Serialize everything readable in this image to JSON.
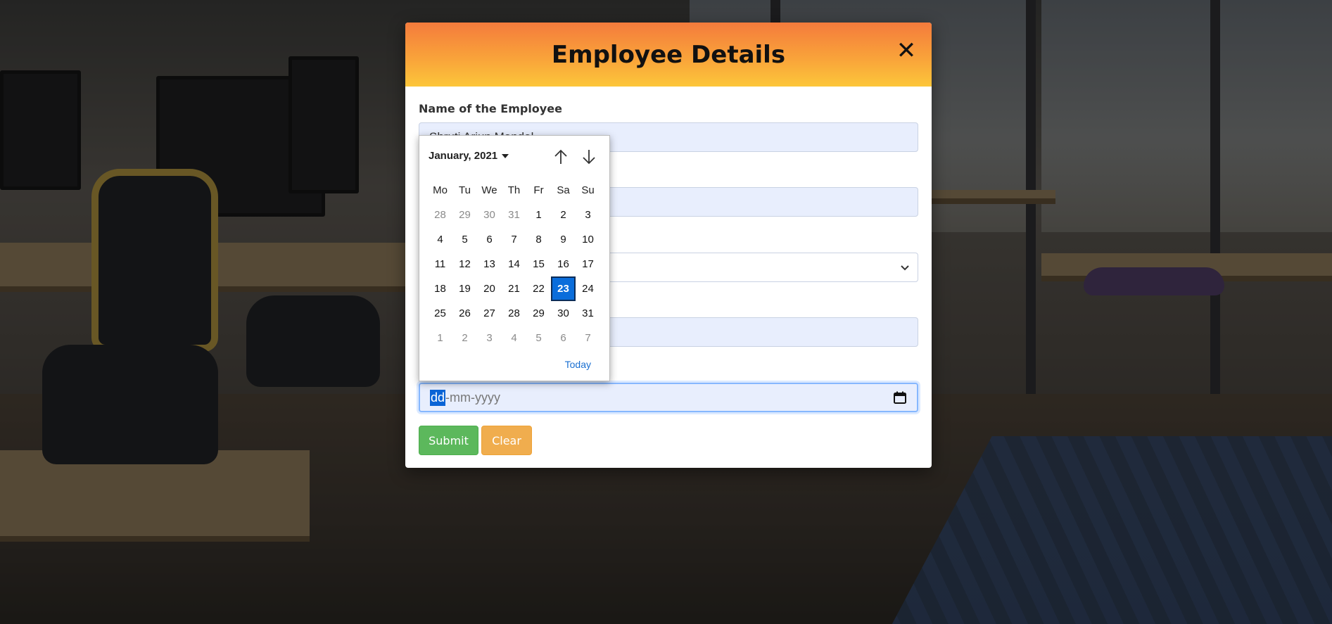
{
  "modal": {
    "title": "Employee Details",
    "close_label": "✕"
  },
  "form": {
    "name_label": "Name of the Employee",
    "name_value": "Shruti Arjun Mandal",
    "date_placeholder_day": "dd",
    "date_placeholder_rest": "-mm-yyyy",
    "submit_label": "Submit",
    "clear_label": "Clear"
  },
  "datepicker": {
    "month_year": "January, 2021",
    "weekdays": [
      "Mo",
      "Tu",
      "We",
      "Th",
      "Fr",
      "Sa",
      "Su"
    ],
    "weeks": [
      [
        "28",
        "29",
        "30",
        "31",
        "1",
        "2",
        "3"
      ],
      [
        "4",
        "5",
        "6",
        "7",
        "8",
        "9",
        "10"
      ],
      [
        "11",
        "12",
        "13",
        "14",
        "15",
        "16",
        "17"
      ],
      [
        "18",
        "19",
        "20",
        "21",
        "22",
        "23",
        "24"
      ],
      [
        "25",
        "26",
        "27",
        "28",
        "29",
        "30",
        "31"
      ],
      [
        "1",
        "2",
        "3",
        "4",
        "5",
        "6",
        "7"
      ]
    ],
    "selected_day": "23",
    "today_label": "Today"
  },
  "colors": {
    "header_gradient_top": "#f47b3c",
    "header_gradient_bottom": "#fcc63a",
    "submit": "#5cb85c",
    "clear": "#f0ad4e",
    "selected_day": "#0a6ddb"
  }
}
